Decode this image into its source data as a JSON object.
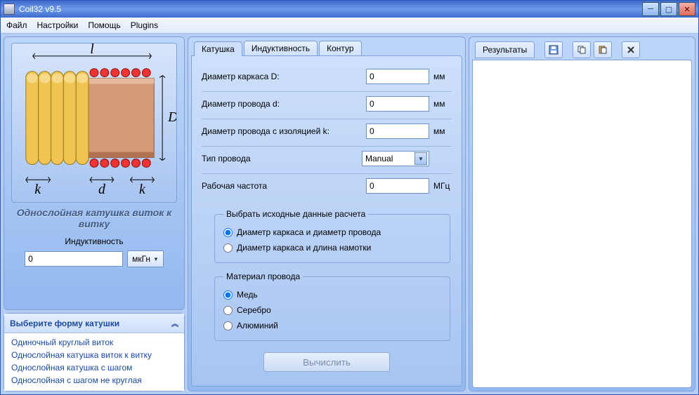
{
  "window": {
    "title": "Coil32 v9.5"
  },
  "menu": {
    "file": "Файл",
    "settings": "Настройки",
    "help": "Помощь",
    "plugins": "Plugins"
  },
  "left": {
    "image_labels": {
      "l": "l",
      "D": "D",
      "k_left": "k",
      "d": "d",
      "k_right": "k"
    },
    "coil_title_1": "Однослойная катушка виток к",
    "coil_title_2": "витку",
    "inductance_label": "Индуктивность",
    "inductance_value": "0",
    "unit_label": "мкГн",
    "list_header": "Выберите форму катушки",
    "list_items": [
      "Одиночный круглый виток",
      "Однослойная катушка виток к витку",
      "Однослойная катушка с шагом",
      "Однослойная с шагом не круглая"
    ]
  },
  "center": {
    "tabs": {
      "coil": "Катушка",
      "inductance": "Индуктивность",
      "contour": "Контур"
    },
    "rows": {
      "D": {
        "label": "Диаметр каркаса D:",
        "value": "0",
        "unit": "мм"
      },
      "d": {
        "label": "Диаметр провода d:",
        "value": "0",
        "unit": "мм"
      },
      "k": {
        "label": "Диаметр провода с изоляцией k:",
        "value": "0",
        "unit": "мм"
      },
      "wire_type": {
        "label": "Тип провода",
        "value": "Manual"
      },
      "freq": {
        "label": "Рабочая частота",
        "value": "0",
        "unit": "МГц"
      }
    },
    "source_group": {
      "legend": "Выбрать исходные данные расчета",
      "opt1": "Диаметр каркаса и диаметр провода",
      "opt2": "Диаметр каркаса и длина намотки",
      "selected": "1"
    },
    "material_group": {
      "legend": "Материал провода",
      "opt1": "Медь",
      "opt2": "Серебро",
      "opt3": "Алюминий",
      "selected": "1"
    },
    "calc_button": "Вычислить"
  },
  "right": {
    "tab": "Результаты"
  }
}
